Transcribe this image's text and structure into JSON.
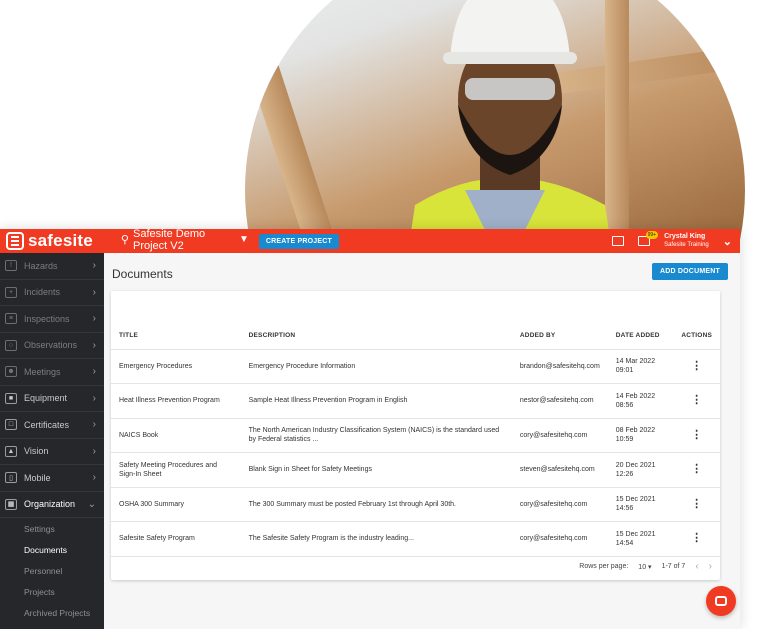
{
  "brand": {
    "name": "safesite",
    "color": "#f13a22"
  },
  "topbar": {
    "project": "Safesite Demo Project V2",
    "create_label": "CREATE PROJECT",
    "badge": "99+",
    "user_name": "Crystal King",
    "user_org": "Safesite Training"
  },
  "sidebar": {
    "items": [
      {
        "label": "Hazards",
        "icon": "warning-icon"
      },
      {
        "label": "Incidents",
        "icon": "incident-icon"
      },
      {
        "label": "Inspections",
        "icon": "checklist-icon"
      },
      {
        "label": "Observations",
        "icon": "search-icon"
      },
      {
        "label": "Meetings",
        "icon": "people-icon"
      },
      {
        "label": "Equipment",
        "icon": "drill-icon"
      },
      {
        "label": "Certificates",
        "icon": "certificate-icon"
      },
      {
        "label": "Vision",
        "icon": "image-icon"
      },
      {
        "label": "Mobile",
        "icon": "phone-icon"
      },
      {
        "label": "Organization",
        "icon": "building-icon"
      }
    ],
    "sub_items": [
      "Settings",
      "Documents",
      "Personnel",
      "Projects",
      "Archived Projects"
    ]
  },
  "main": {
    "title": "Documents",
    "add_label": "ADD DOCUMENT",
    "columns": [
      "TITLE",
      "DESCRIPTION",
      "ADDED BY",
      "DATE ADDED",
      "ACTIONS"
    ],
    "rows": [
      {
        "title": "Emergency Procedures",
        "description": "Emergency Procedure Information",
        "added_by": "brandon@safesitehq.com",
        "date": "14 Mar 2022",
        "time": "09:01"
      },
      {
        "title": "Heat Illness Prevention Program",
        "description": "Sample Heat Illness Prevention Program in English",
        "added_by": "nestor@safesitehq.com",
        "date": "14 Feb 2022",
        "time": "08:56"
      },
      {
        "title": "NAICS Book",
        "description": "The North American Industry Classification System (NAICS) is the standard used by Federal statistics ...",
        "added_by": "cory@safesitehq.com",
        "date": "08 Feb 2022",
        "time": "10:59"
      },
      {
        "title": "Safety Meeting Procedures and Sign-In Sheet",
        "description": "Blank Sign in Sheet for Safety Meetings",
        "added_by": "steven@safesitehq.com",
        "date": "20 Dec 2021",
        "time": "12:26"
      },
      {
        "title": "OSHA 300 Summary",
        "description": "The 300 Summary must be posted February 1st through April 30th.",
        "added_by": "cory@safesitehq.com",
        "date": "15 Dec 2021",
        "time": "14:56"
      },
      {
        "title": "Safesite Safety Program",
        "description": "The Safesite Safety Program is the industry leading...",
        "added_by": "cory@safesitehq.com",
        "date": "15 Dec 2021",
        "time": "14:54"
      }
    ],
    "pagination": {
      "rows_label": "Rows per page:",
      "rows_value": "10",
      "range": "1-7 of 7"
    }
  },
  "accent": "#1a8ad0"
}
